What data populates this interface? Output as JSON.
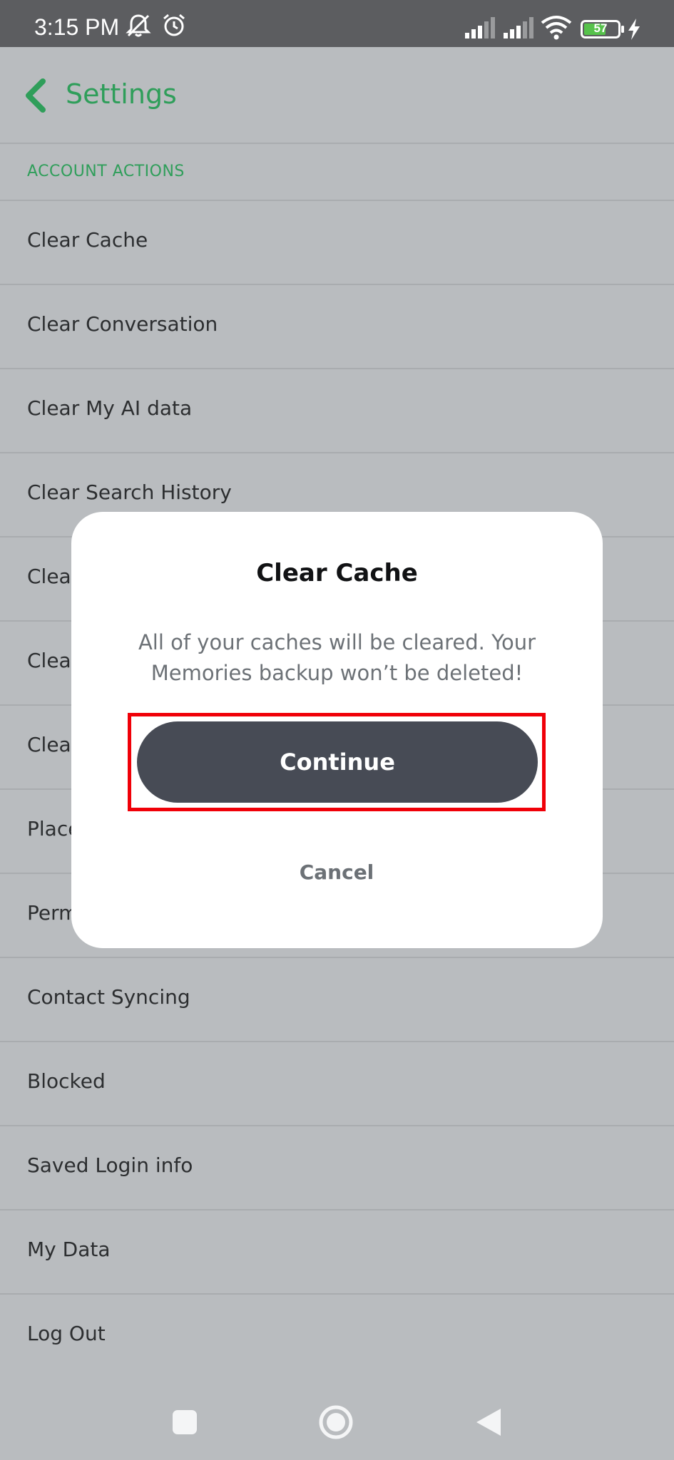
{
  "status_bar": {
    "time": "3:15 PM",
    "battery": "57",
    "icons": [
      "notifications-muted-icon",
      "alarm-icon",
      "signal-icon",
      "signal-icon",
      "wifi-icon",
      "battery-icon",
      "charging-icon"
    ]
  },
  "header": {
    "title": "Settings",
    "back_icon": "chevron-left-icon"
  },
  "section": {
    "label": "ACCOUNT ACTIONS"
  },
  "settings_items": [
    {
      "label": "Clear Cache"
    },
    {
      "label": "Clear Conversation"
    },
    {
      "label": "Clear My AI data"
    },
    {
      "label": "Clear Search History"
    },
    {
      "label": "Clea"
    },
    {
      "label": "Clea"
    },
    {
      "label": "Clea"
    },
    {
      "label": "Place"
    },
    {
      "label": "Perm"
    },
    {
      "label": "Contact Syncing"
    },
    {
      "label": "Blocked"
    },
    {
      "label": "Saved Login info"
    },
    {
      "label": "My Data"
    },
    {
      "label": "Log Out"
    }
  ],
  "dialog": {
    "title": "Clear Cache",
    "message": "All of your caches will be cleared. Your Memories backup won’t be deleted!",
    "continue_label": "Continue",
    "cancel_label": "Cancel"
  },
  "nav_bar": {
    "icons": [
      "recents-square-icon",
      "home-circle-icon",
      "back-triangle-icon"
    ]
  },
  "colors": {
    "accent": "#2f9e5a",
    "overlay_background": "#b9bcbf",
    "status_bar": "#5c5d60",
    "primary_button": "#474b55",
    "highlight": "#f00008"
  }
}
